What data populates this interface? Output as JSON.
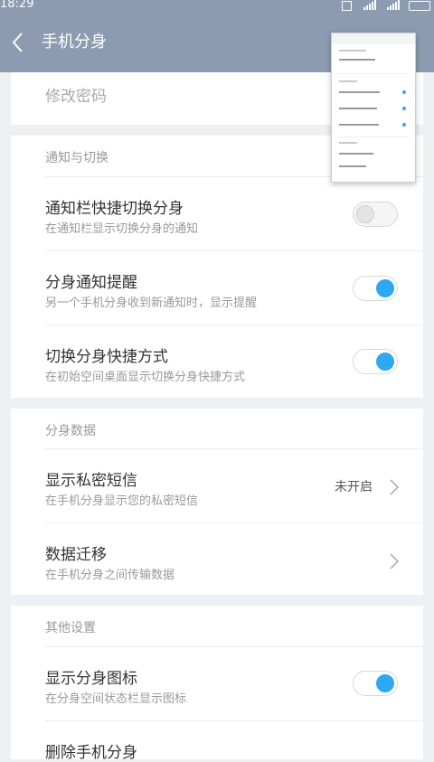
{
  "status_bar": {
    "time": "18:29"
  },
  "header": {
    "title": "手机分身",
    "back_icon": "chevron-left-icon"
  },
  "top_item": {
    "label": "修改密码"
  },
  "section_notify": {
    "title": "通知与切换",
    "items": [
      {
        "title": "通知栏快捷切换分身",
        "subtitle": "在通知栏显示切换分身的通知",
        "enabled": false
      },
      {
        "title": "分身通知提醒",
        "subtitle": "另一个手机分身收到新通知时，显示提醒",
        "enabled": true
      },
      {
        "title": "切换分身快捷方式",
        "subtitle": "在初始空间桌面显示切换分身快捷方式",
        "enabled": true
      }
    ]
  },
  "section_data": {
    "title": "分身数据",
    "items": [
      {
        "title": "显示私密短信",
        "subtitle": "在手机分身显示您的私密短信",
        "value": "未开启"
      },
      {
        "title": "数据迁移",
        "subtitle": "在手机分身之间传输数据"
      }
    ]
  },
  "section_other": {
    "title": "其他设置",
    "items": [
      {
        "title": "显示分身图标",
        "subtitle": "在分身空间状态栏显示图标",
        "enabled": true
      },
      {
        "title": "删除手机分身"
      }
    ]
  },
  "colors": {
    "header": "#8c9bb0",
    "accent": "#2ea8f5",
    "background": "#eef0f3"
  }
}
